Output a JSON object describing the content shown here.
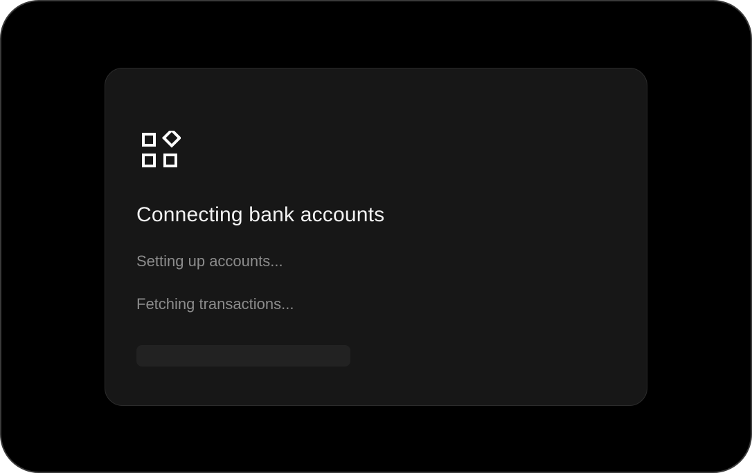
{
  "dialog": {
    "icon": "apps-grid-icon",
    "title": "Connecting bank accounts",
    "steps": [
      {
        "label": "Setting up accounts..."
      },
      {
        "label": "Fetching transactions..."
      }
    ],
    "progress": 0
  },
  "colors": {
    "background": "#000000",
    "card": "#171717",
    "title": "#f2f2f2",
    "step_text": "#8c8c8c",
    "progress_track": "#222222"
  }
}
